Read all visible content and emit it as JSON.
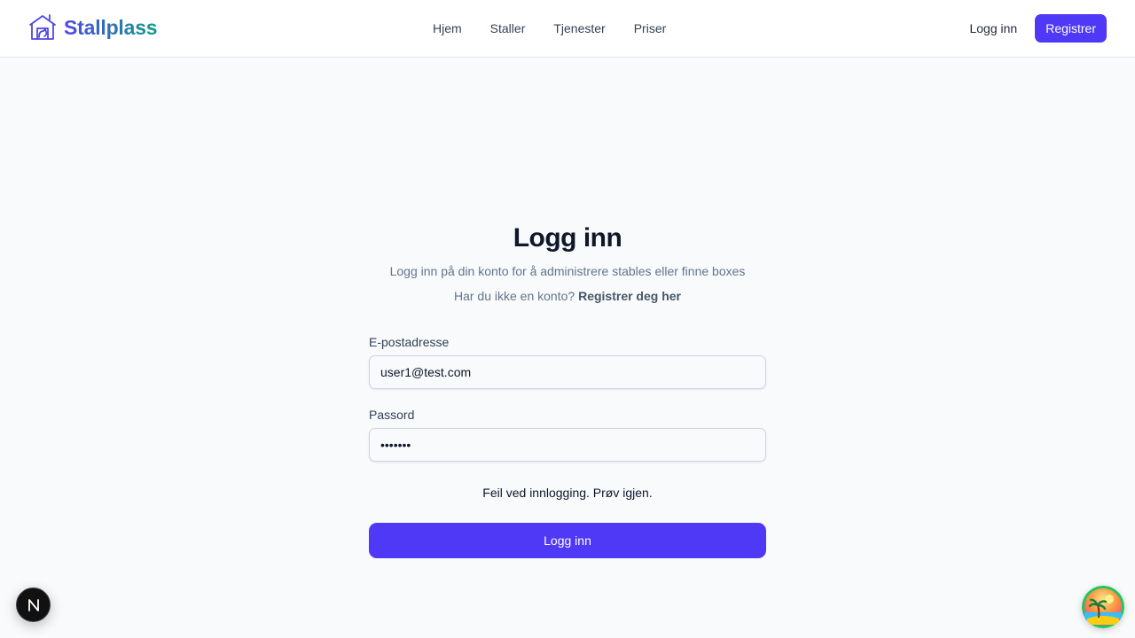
{
  "brand": {
    "name": "Stallplass",
    "accent": "#4f38f6",
    "gradient_start": "#4f46e5",
    "gradient_end": "#0f9a8a"
  },
  "nav": {
    "items": [
      {
        "label": "Hjem"
      },
      {
        "label": "Staller"
      },
      {
        "label": "Tjenester"
      },
      {
        "label": "Priser"
      }
    ]
  },
  "auth": {
    "login_label": "Logg inn",
    "register_label": "Registrer"
  },
  "page": {
    "title": "Logg inn",
    "subtitle": "Logg inn på din konto for å administrere stables eller finne boxes",
    "signup_prompt": "Har du ikke en konto?",
    "signup_link": "Registrer deg her"
  },
  "form": {
    "email_label": "E-postadresse",
    "email_value": "user1@test.com",
    "password_label": "Passord",
    "password_value": "1234567",
    "error": "Feil ved innlogging. Prøv igjen.",
    "submit_label": "Logg inn"
  },
  "icons": {
    "logo": "stable-house-icon",
    "dev_badge": "nextjs-logo-icon",
    "avatar": "beach-palm-avatar-icon"
  }
}
